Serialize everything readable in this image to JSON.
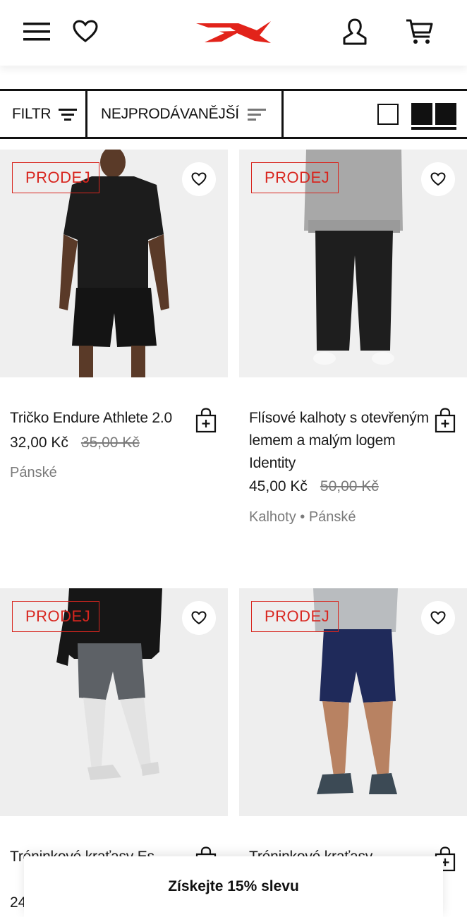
{
  "header": {
    "menu_icon": "hamburger-menu-icon",
    "wishlist_icon": "heart-icon",
    "logo": "reebok-logo",
    "account_icon": "user-icon",
    "cart_icon": "shopping-cart-icon",
    "brand_color": "#e2231a"
  },
  "toolbar": {
    "filter_label": "FILTR",
    "sort_label": "NEJPRODÁVANĚJŠÍ",
    "view_single_icon": "single-column-view-icon",
    "view_double_icon": "two-column-view-icon"
  },
  "products": [
    {
      "badge": "PRODEJ",
      "title": "Tričko Endure Athlete 2.0",
      "price": "32,00 Kč",
      "old_price": "35,00 Kč",
      "meta": "Pánské"
    },
    {
      "badge": "PRODEJ",
      "title": "Flísové kalhoty s otevřeným lemem a malým logem Identity",
      "price": "45,00 Kč",
      "old_price": "50,00 Kč",
      "meta": "Kalhoty • Pánské"
    },
    {
      "badge": "PRODEJ",
      "title": "Tréninkové kraťasy Es",
      "price": "24",
      "old_price": "",
      "meta": ""
    },
    {
      "badge": "PRODEJ",
      "title": "Tréninkové kraťasy",
      "price": "",
      "old_price": "",
      "meta": ""
    }
  ],
  "colors": {
    "sale": "#d8261f",
    "muted": "#7a7a7a"
  },
  "promo": {
    "label": "Získejte 15% slevu"
  }
}
